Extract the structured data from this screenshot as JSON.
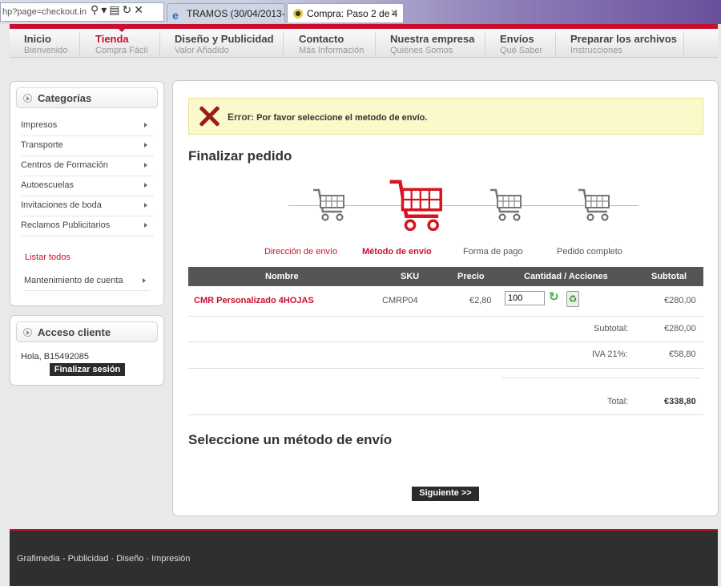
{
  "browser": {
    "address": "hp?page=checkout.in",
    "tabs": [
      {
        "label": "TRAMOS (30/04/2013-..."
      },
      {
        "label": "Compra: Paso 2 de 4"
      }
    ],
    "close_symbol": "✕"
  },
  "nav": [
    {
      "title": "Inicio",
      "subtitle": "Bienvenido"
    },
    {
      "title": "Tienda",
      "subtitle": "Compra Fácil"
    },
    {
      "title": "Diseño y Publicidad",
      "subtitle": "Valor Añadido"
    },
    {
      "title": "Contacto",
      "subtitle": "Más Información"
    },
    {
      "title": "Nuestra empresa",
      "subtitle": "Quiénes Somos"
    },
    {
      "title": "Envíos",
      "subtitle": "Qué Saber"
    },
    {
      "title": "Preparar los archivos",
      "subtitle": "Instrucciones"
    }
  ],
  "sidebar": {
    "categories_title": "Categorías",
    "categories": [
      "Impresos",
      "Transporte",
      "Centros de Formación",
      "Autoescuelas",
      "Invitaciones de boda",
      "Reclamos Publicitarios"
    ],
    "list_all": "Listar todos",
    "account": "Mantenimiento de cuenta",
    "client_title": "Acceso cliente",
    "greeting": "Hola, B15492085",
    "logout": "Finalizar sesión"
  },
  "error": {
    "label": "Error",
    "message": ": Por favor seleccione el metodo de envío."
  },
  "checkout": {
    "title": "Finalizar pedido",
    "steps": [
      "Dirección de envío",
      "Método de envío",
      "Forma de pago",
      "Pedido completo"
    ],
    "active_step": 1
  },
  "table": {
    "headers": [
      "Nombre",
      "SKU",
      "Precio",
      "Cantidad / Acciones",
      "Subtotal"
    ],
    "row": {
      "name": "CMR Personalizado 4HOJAS",
      "sku": "CMRP04",
      "price": "€2,80",
      "quantity": "100",
      "subtotal": "€280,00"
    },
    "totals": [
      {
        "label": "Subtotal:",
        "value": "€280,00"
      },
      {
        "label": "IVA 21%:",
        "value": "€58,80"
      },
      {
        "label": "Total:",
        "value": "€338,80"
      }
    ]
  },
  "shipping_title": "Seleccione un método de envío",
  "next_button": "Siguiente >>",
  "footer": "Grafimedia - Publicidad · Diseño · Impresión",
  "colors": {
    "accent": "#c8102e",
    "table_header": "#555555",
    "error_bg": "#fbf8c9"
  }
}
